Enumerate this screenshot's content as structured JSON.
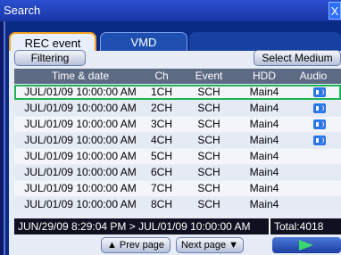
{
  "window": {
    "title": "Search",
    "close_symbol": "X"
  },
  "tabs": [
    {
      "label": "REC event",
      "active": true
    },
    {
      "label": "VMD",
      "active": false
    }
  ],
  "toolbar": {
    "filtering_label": "Filtering",
    "select_medium_label": "Select Medium"
  },
  "table": {
    "headers": [
      "Time & date",
      "Ch",
      "Event",
      "HDD",
      "Audio"
    ],
    "rows": [
      {
        "time": "JUL/01/09 10:00:00 AM",
        "ch": "1CH",
        "event": "SCH",
        "hdd": "Main4",
        "audio": true,
        "selected": true
      },
      {
        "time": "JUL/01/09 10:00:00 AM",
        "ch": "2CH",
        "event": "SCH",
        "hdd": "Main4",
        "audio": true
      },
      {
        "time": "JUL/01/09 10:00:00 AM",
        "ch": "3CH",
        "event": "SCH",
        "hdd": "Main4",
        "audio": true
      },
      {
        "time": "JUL/01/09 10:00:00 AM",
        "ch": "4CH",
        "event": "SCH",
        "hdd": "Main4",
        "audio": true
      },
      {
        "time": "JUL/01/09 10:00:00 AM",
        "ch": "5CH",
        "event": "SCH",
        "hdd": "Main4",
        "audio": false
      },
      {
        "time": "JUL/01/09 10:00:00 AM",
        "ch": "6CH",
        "event": "SCH",
        "hdd": "Main4",
        "audio": false
      },
      {
        "time": "JUL/01/09 10:00:00 AM",
        "ch": "7CH",
        "event": "SCH",
        "hdd": "Main4",
        "audio": false
      },
      {
        "time": "JUL/01/09 10:00:00 AM",
        "ch": "8CH",
        "event": "SCH",
        "hdd": "Main4",
        "audio": false
      }
    ]
  },
  "footer": {
    "range": "JUN/29/09  8:29:04 PM > JUL/01/09 10:00:00 AM",
    "total": "Total:4018",
    "prev_label": "▲ Prev page",
    "next_label": "Next page ▼",
    "play_icon": "play-icon"
  },
  "colors": {
    "accent_tab_border": "#f5a321",
    "selected_row_outline": "#1eb356",
    "speaker_icon": "#2b75e8",
    "play_arrow": "#38d86a"
  }
}
